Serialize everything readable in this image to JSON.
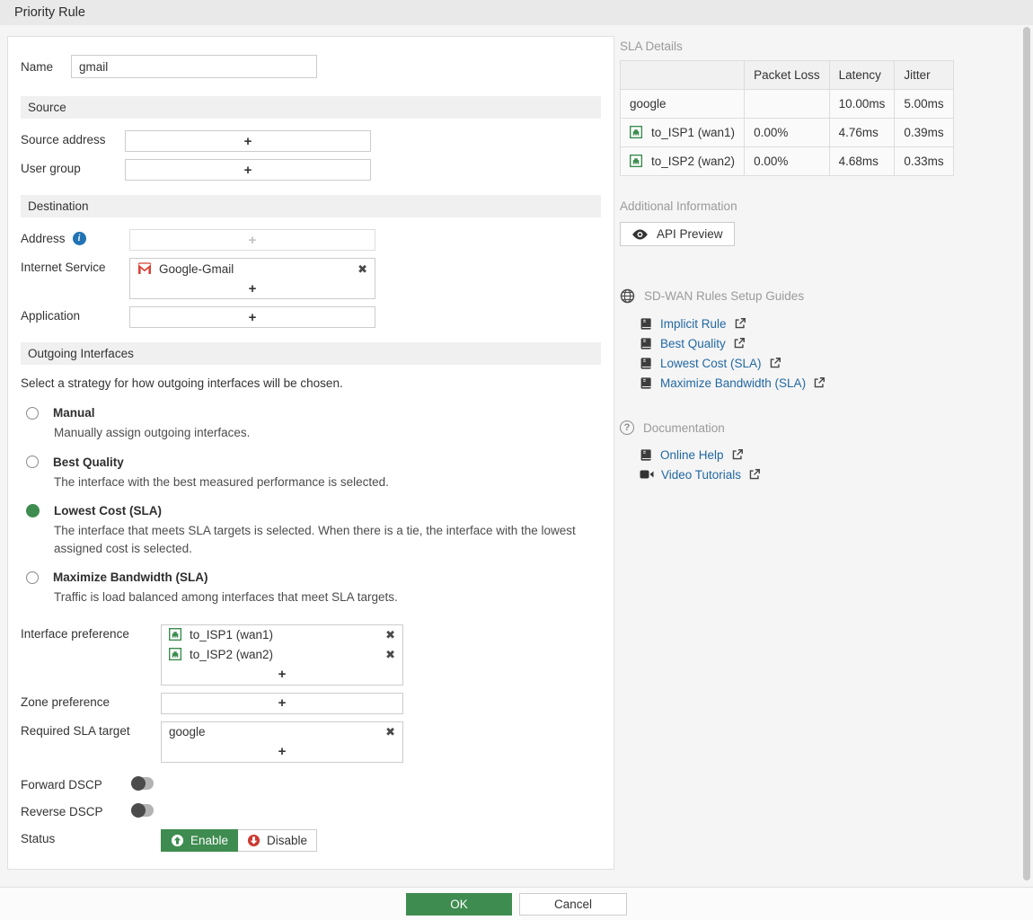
{
  "titlebar": {
    "title": "Priority Rule"
  },
  "icons": {
    "plus": "+",
    "remove": "✖",
    "info": "i",
    "question": "?"
  },
  "form": {
    "name": {
      "label": "Name",
      "value": "gmail"
    },
    "source": {
      "header": "Source",
      "source_address_label": "Source address",
      "user_group_label": "User group"
    },
    "destination": {
      "header": "Destination",
      "address_label": "Address",
      "internet_service_label": "Internet Service",
      "internet_service_items": [
        "Google-Gmail"
      ],
      "application_label": "Application"
    },
    "outgoing": {
      "header": "Outgoing Interfaces",
      "intro": "Select a strategy for how outgoing interfaces will be chosen.",
      "strategies": [
        {
          "label": "Manual",
          "description": "Manually assign outgoing interfaces."
        },
        {
          "label": "Best Quality",
          "description": "The interface with the best measured performance is selected."
        },
        {
          "label": "Lowest Cost (SLA)",
          "description": "The interface that meets SLA targets is selected. When there is a tie, the interface with the lowest assigned cost is selected."
        },
        {
          "label": "Maximize Bandwidth (SLA)",
          "description": "Traffic is load balanced among interfaces that meet SLA targets."
        }
      ],
      "selected_strategy": "Lowest Cost (SLA)",
      "interface_preference": {
        "label": "Interface preference",
        "items": [
          "to_ISP1 (wan1)",
          "to_ISP2 (wan2)"
        ]
      },
      "zone_preference": {
        "label": "Zone preference"
      },
      "required_sla_target": {
        "label": "Required SLA target",
        "items": [
          "google"
        ]
      },
      "forward_dscp_label": "Forward DSCP",
      "reverse_dscp_label": "Reverse DSCP",
      "status": {
        "label": "Status",
        "enable_label": "Enable",
        "disable_label": "Disable",
        "value": "Enable"
      }
    }
  },
  "sidebar": {
    "sla_details": {
      "title": "SLA Details",
      "columns": [
        "",
        "Packet Loss",
        "Latency",
        "Jitter"
      ],
      "rows": [
        {
          "name": "google",
          "packet_loss": "",
          "latency": "10.00ms",
          "jitter": "5.00ms"
        },
        {
          "name": "to_ISP1 (wan1)",
          "packet_loss": "0.00%",
          "latency": "4.76ms",
          "jitter": "0.39ms"
        },
        {
          "name": "to_ISP2 (wan2)",
          "packet_loss": "0.00%",
          "latency": "4.68ms",
          "jitter": "0.33ms"
        }
      ]
    },
    "additional_information": {
      "title": "Additional Information",
      "api_preview_label": "API Preview"
    },
    "setup_guides": {
      "title": "SD-WAN Rules Setup Guides",
      "links": [
        "Implicit Rule",
        "Best Quality",
        "Lowest Cost (SLA)",
        "Maximize Bandwidth (SLA)"
      ]
    },
    "documentation": {
      "title": "Documentation",
      "links": [
        "Online Help",
        "Video Tutorials"
      ]
    }
  },
  "footer": {
    "ok_label": "OK",
    "cancel_label": "Cancel"
  }
}
